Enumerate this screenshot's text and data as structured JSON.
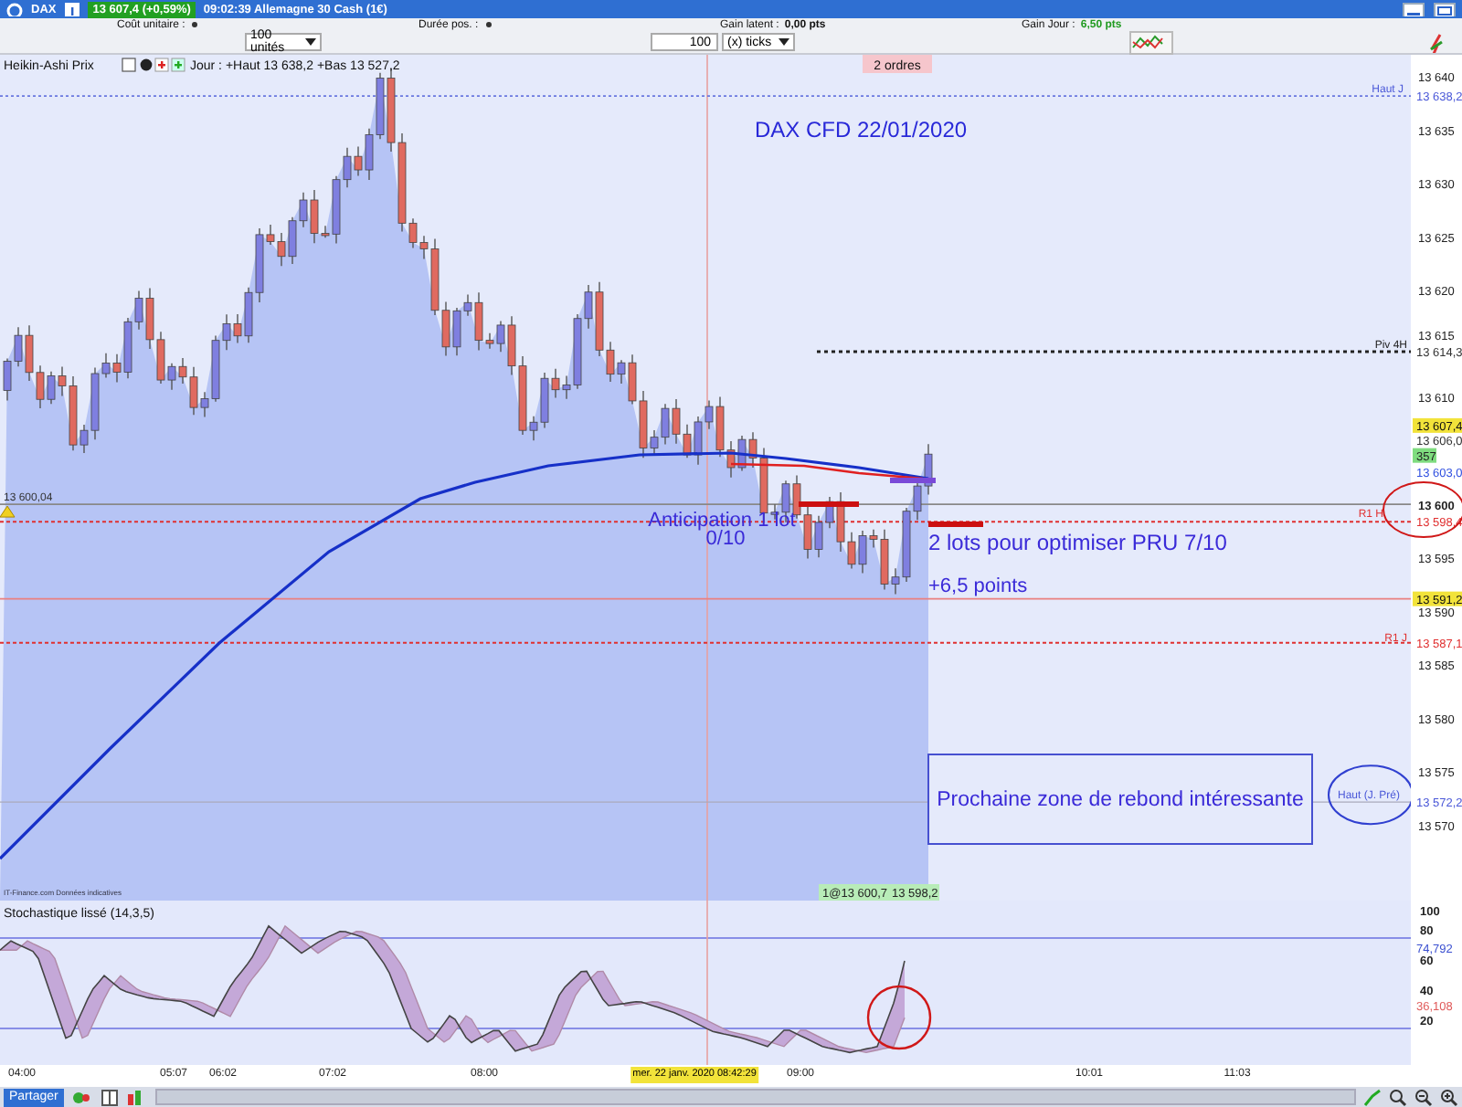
{
  "title_bar": {
    "symbol": "DAX",
    "quote": "13 607,4 (+0,59%)",
    "instrument": "09:02:39 Allemagne 30 Cash (1€)"
  },
  "order_panel": {
    "stats": [
      {
        "label": "Coût unitaire :",
        "kind": "menu"
      },
      {
        "label": "Durée pos. :",
        "kind": "menu"
      },
      {
        "label": "Gain latent :",
        "value": "0,00 pts",
        "kind": "value",
        "color": "#111111"
      },
      {
        "label": "Gain Jour :",
        "value": "6,50 pts",
        "kind": "value",
        "color": "#1f9a1f"
      }
    ],
    "quantity": "100 unités",
    "ticks_value": "100",
    "ticks_unit": "(x) ticks"
  },
  "chart": {
    "style": "Heikin-Ashi Prix",
    "day_range": "Jour : +Haut 13 638,2 +Bas 13 527,2",
    "orders": "2 ordres",
    "title": "DAX CFD 22/01/2020",
    "notes": [
      {
        "text": "Anticipation 1 lot"
      },
      {
        "text": "0/10"
      },
      {
        "text": "2 lots pour optimiser PRU 7/10"
      },
      {
        "text": "+6,5 points"
      }
    ],
    "callout": "Prochaine zone de rebond intéressante",
    "levels": [
      {
        "label": "Haut J",
        "color": "#4a58d8"
      },
      {
        "label": "Piv 4H",
        "color": "#222222"
      },
      {
        "label": "13 600,04",
        "color": "#333333"
      },
      {
        "label": "R1 H",
        "color": "#e03030"
      },
      {
        "label": "R1 J",
        "color": "#e03030"
      },
      {
        "label": "Haut (J. Pré)",
        "color": "#4a58d8"
      }
    ],
    "price_ticks": [
      "13 640",
      "13 635",
      "13 630",
      "13 625",
      "13 620",
      "13 615",
      "13 610",
      "13 600",
      "13 595",
      "13 590",
      "13 585",
      "13 580",
      "13 575",
      "13 570"
    ],
    "price_tags": [
      {
        "text": "13 638,2",
        "kind": "plain",
        "color": "#4a58d8"
      },
      {
        "text": "13 614,3",
        "kind": "plain",
        "color": "#333333"
      },
      {
        "text": "13 607,4",
        "kind": "highlight",
        "color": "#111111"
      },
      {
        "text": "13 606,0",
        "kind": "plain",
        "color": "#333333"
      },
      {
        "text": "357",
        "kind": "badge"
      },
      {
        "text": "13 603,0",
        "kind": "plain",
        "color": "#3050e0"
      },
      {
        "text": "13 598,4",
        "kind": "plain",
        "color": "#e03030"
      },
      {
        "text": "13 591,2",
        "kind": "highlight",
        "color": "#111111"
      },
      {
        "text": "13 587,1",
        "kind": "plain",
        "color": "#e03030"
      },
      {
        "text": "13 572,2",
        "kind": "plain",
        "color": "#4a58d8"
      }
    ],
    "position_tag": {
      "entry": "1@13 600,7",
      "stop": "13 598,2"
    },
    "source": "IT-Finance.com Données indicatives"
  },
  "stochastic": {
    "title": "Stochastique lissé (14,3,5)",
    "ticks": [
      "100",
      "80",
      "60",
      "40",
      "20"
    ],
    "tags": [
      {
        "text": "74,792",
        "color": "#3a4fd0"
      },
      {
        "text": "36,108",
        "color": "#e05a5a"
      }
    ]
  },
  "time_axis": {
    "labels": [
      "04:00",
      "05:07",
      "06:02",
      "07:02",
      "08:00",
      "09:00",
      "10:01",
      "11:03"
    ],
    "cursor": "mer. 22 janv. 2020 08:42:29"
  },
  "footer": {
    "share": "Partager"
  }
}
